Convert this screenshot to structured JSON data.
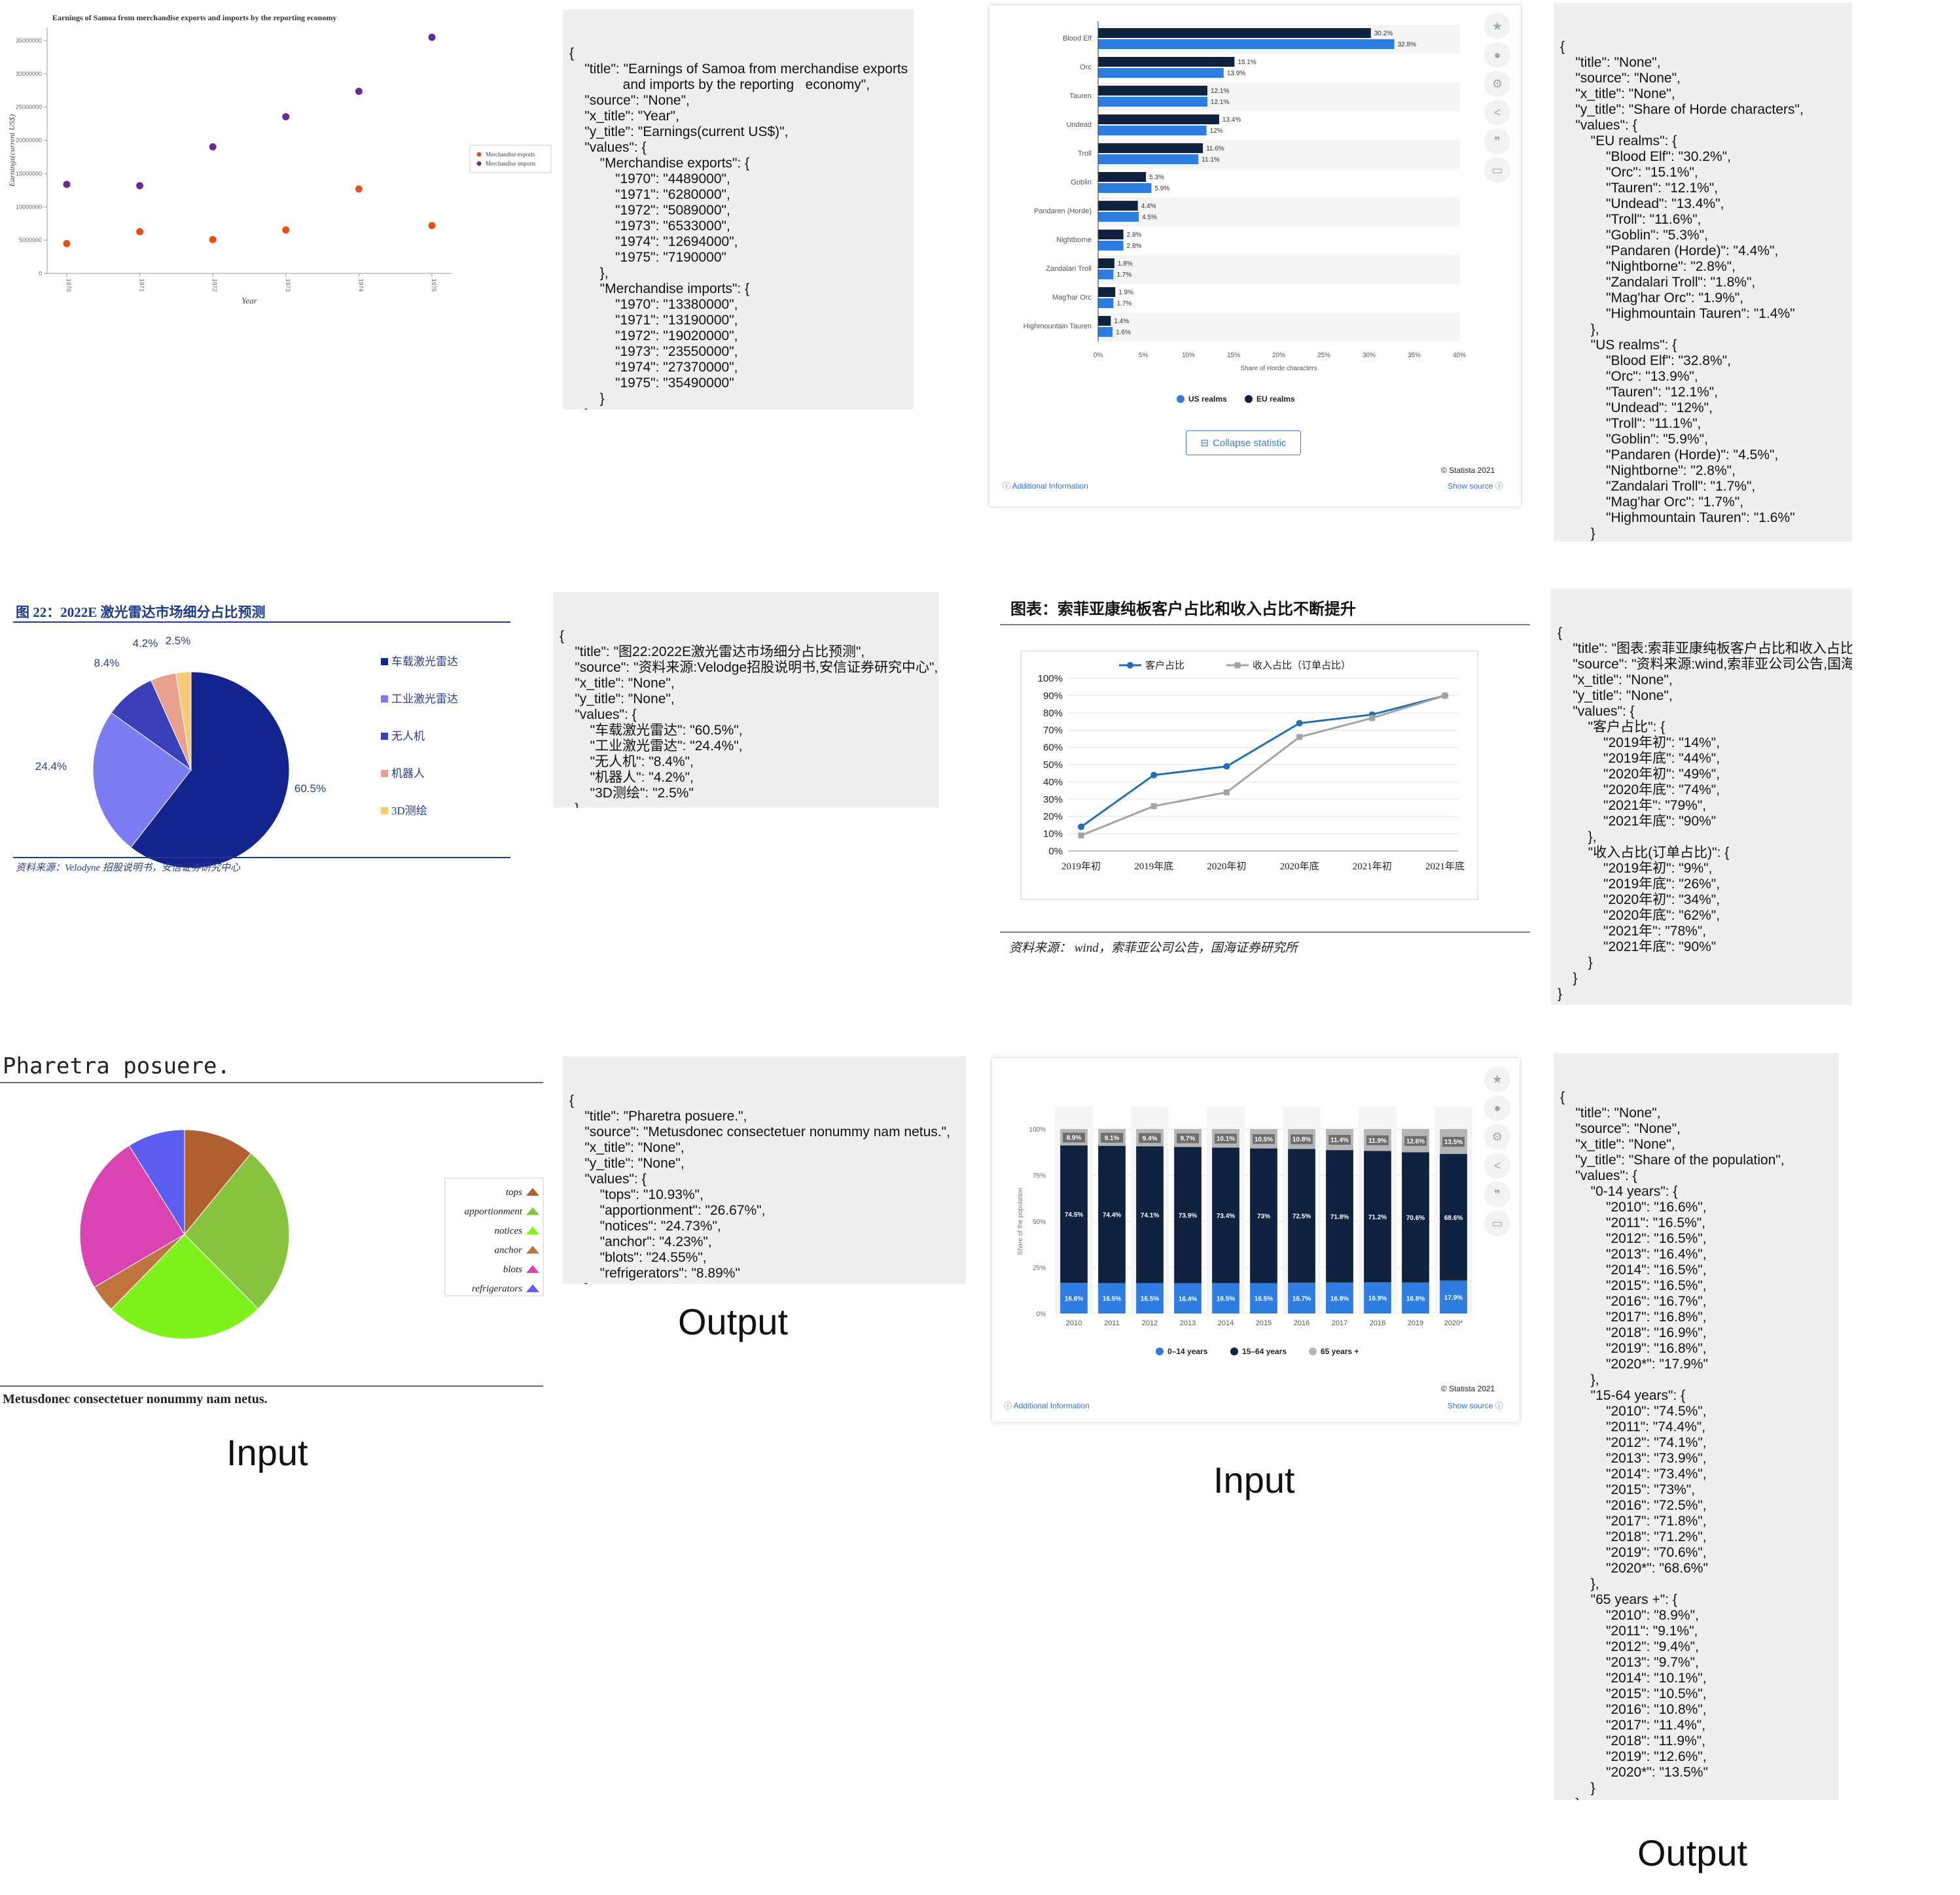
{
  "captions": {
    "input_1": "Input",
    "output_1": "Output",
    "input_2": "Input",
    "output_2": "Output"
  },
  "json_boxes": {
    "samoa": "{\n    \"title\": \"Earnings of Samoa from merchandise exports\n              and imports by the reporting   economy\",\n    \"source\": \"None\",\n    \"x_title\": \"Year\",\n    \"y_title\": \"Earnings(current US$)\",\n    \"values\": {\n        \"Merchandise exports\": {\n            \"1970\": \"4489000\",\n            \"1971\": \"6280000\",\n            \"1972\": \"5089000\",\n            \"1973\": \"6533000\",\n            \"1974\": \"12694000\",\n            \"1975\": \"7190000\"\n        },\n        \"Merchandise imports\": {\n            \"1970\": \"13380000\",\n            \"1971\": \"13190000\",\n            \"1972\": \"19020000\",\n            \"1973\": \"23550000\",\n            \"1974\": \"27370000\",\n            \"1975\": \"35490000\"\n        }\n    }\n}",
    "horde": "{\n    \"title\": \"None\",\n    \"source\": \"None\",\n    \"x_title\": \"None\",\n    \"y_title\": \"Share of Horde characters\",\n    \"values\": {\n        \"EU realms\": {\n            \"Blood Elf\": \"30.2%\",\n            \"Orc\": \"15.1%\",\n            \"Tauren\": \"12.1%\",\n            \"Undead\": \"13.4%\",\n            \"Troll\": \"11.6%\",\n            \"Goblin\": \"5.3%\",\n            \"Pandaren (Horde)\": \"4.4%\",\n            \"Nightborne\": \"2.8%\",\n            \"Zandalari Troll\": \"1.8%\",\n            \"Mag'har Orc\": \"1.9%\",\n            \"Highmountain Tauren\": \"1.4%\"\n        },\n        \"US realms\": {\n            \"Blood Elf\": \"32.8%\",\n            \"Orc\": \"13.9%\",\n            \"Tauren\": \"12.1%\",\n            \"Undead\": \"12%\",\n            \"Troll\": \"11.1%\",\n            \"Goblin\": \"5.9%\",\n            \"Pandaren (Horde)\": \"4.5%\",\n            \"Nightborne\": \"2.8%\",\n            \"Zandalari Troll\": \"1.7%\",\n            \"Mag'har Orc\": \"1.7%\",\n            \"Highmountain Tauren\": \"1.6%\"\n        }\n    }\n}",
    "lidar": "{\n    \"title\": \"图22:2022E激光雷达市场细分占比预测\",\n    \"source\": \"资料来源:Velodge招股说明书,安信证券研究中心\",\n    \"x_title\": \"None\",\n    \"y_title\": \"None\",\n    \"values\": {\n        \"车载激光雷达\": \"60.5%\",\n        \"工业激光雷达\": \"24.4%\",\n        \"无人机\": \"8.4%\",\n        \"机器人\": \"4.2%\",\n        \"3D测绘\": \"2.5%\"\n    }\n}",
    "sofia": "{\n    \"title\": \"图表:索菲亚康纯板客户占比和收入占比不断提升\",\n    \"source\": \"资料来源:wind,索菲亚公司公告,国海证券研究所\",\n    \"x_title\": \"None\",\n    \"y_title\": \"None\",\n    \"values\": {\n        \"客户占比\": {\n            \"2019年初\": \"14%\",\n            \"2019年底\": \"44%\",\n            \"2020年初\": \"49%\",\n            \"2020年底\": \"74%\",\n            \"2021年\": \"79%\",\n            \"2021年底\": \"90%\"\n        },\n        \"收入占比(订单占比)\": {\n            \"2019年初\": \"9%\",\n            \"2019年底\": \"26%\",\n            \"2020年初\": \"34%\",\n            \"2020年底\": \"62%\",\n            \"2021年\": \"78%\",\n            \"2021年底\": \"90%\"\n        }\n    }\n}",
    "pharetra": "{\n    \"title\": \"Pharetra posuere.\",\n    \"source\": \"Metusdonec consectetuer nonummy nam netus.\",\n    \"x_title\": \"None\",\n    \"y_title\": \"None\",\n    \"values\": {\n        \"tops\": \"10.93%\",\n        \"apportionment\": \"26.67%\",\n        \"notices\": \"24.73%\",\n        \"anchor\": \"4.23%\",\n        \"blots\": \"24.55%\",\n        \"refrigerators\": \"8.89%\"\n    }\n}",
    "population": "{\n    \"title\": \"None\",\n    \"source\": \"None\",\n    \"x_title\": \"None\",\n    \"y_title\": \"Share of the population\",\n    \"values\": {\n        \"0-14 years\": {\n            \"2010\": \"16.6%\",\n            \"2011\": \"16.5%\",\n            \"2012\": \"16.5%\",\n            \"2013\": \"16.4%\",\n            \"2014\": \"16.5%\",\n            \"2015\": \"16.5%\",\n            \"2016\": \"16.7%\",\n            \"2017\": \"16.8%\",\n            \"2018\": \"16.9%\",\n            \"2019\": \"16.8%\",\n            \"2020*\": \"17.9%\"\n        },\n        \"15-64 years\": {\n            \"2010\": \"74.5%\",\n            \"2011\": \"74.4%\",\n            \"2012\": \"74.1%\",\n            \"2013\": \"73.9%\",\n            \"2014\": \"73.4%\",\n            \"2015\": \"73%\",\n            \"2016\": \"72.5%\",\n            \"2017\": \"71.8%\",\n            \"2018\": \"71.2%\",\n            \"2019\": \"70.6%\",\n            \"2020*\": \"68.6%\"\n        },\n        \"65 years +\": {\n            \"2010\": \"8.9%\",\n            \"2011\": \"9.1%\",\n            \"2012\": \"9.4%\",\n            \"2013\": \"9.7%\",\n            \"2014\": \"10.1%\",\n            \"2015\": \"10.5%\",\n            \"2016\": \"10.8%\",\n            \"2017\": \"11.4%\",\n            \"2018\": \"11.9%\",\n            \"2019\": \"12.6%\",\n            \"2020*\": \"13.5%\"\n        }\n    }\n}"
  },
  "statista": {
    "collapse_label": "Collapse statistic",
    "copyright": "© Statista 2021",
    "additional_info": "Additional Information",
    "show_source": "Show source"
  },
  "chart_data": [
    {
      "id": "samoa",
      "type": "scatter",
      "title": "Earnings of Samoa from merchandise exports and imports by the reporting economy",
      "xlabel": "Year",
      "ylabel": "Earnings(current US$)",
      "x": [
        "1970",
        "1971",
        "1972",
        "1973",
        "1974",
        "1975"
      ],
      "ylim": [
        0,
        35000000
      ],
      "yticks": [
        "0",
        "5000000",
        "10000000",
        "15000000",
        "20000000",
        "25000000",
        "30000000",
        "35000000"
      ],
      "series": [
        {
          "name": "Merchandise exports",
          "color": "#e8501a",
          "values": [
            4489000,
            6280000,
            5089000,
            6533000,
            12694000,
            7190000
          ]
        },
        {
          "name": "Merchandise imports",
          "color": "#6a2c91",
          "values": [
            13380000,
            13190000,
            19020000,
            23550000,
            27370000,
            35490000
          ]
        }
      ],
      "legend": "right"
    },
    {
      "id": "horde",
      "type": "bar",
      "orientation": "horizontal",
      "xlabel": "Share of Horde characters",
      "categories": [
        "Blood Elf",
        "Orc",
        "Tauren",
        "Undead",
        "Troll",
        "Goblin",
        "Pandaren (Horde)",
        "Nightborne",
        "Zandalari Troll",
        "Mag'har Orc",
        "Highmountain Tauren"
      ],
      "xticks": [
        "0%",
        "5%",
        "10%",
        "15%",
        "20%",
        "25%",
        "30%",
        "35%",
        "40%"
      ],
      "xlim": [
        0,
        40
      ],
      "series": [
        {
          "name": "EU realms",
          "color": "#0f2240",
          "values": [
            30.2,
            15.1,
            12.1,
            13.4,
            11.6,
            5.3,
            4.4,
            2.8,
            1.8,
            1.9,
            1.4
          ],
          "labels": [
            "30.2%",
            "15.1%",
            "12.1%",
            "13.4%",
            "11.6%",
            "5.3%",
            "4.4%",
            "2.8%",
            "1.8%",
            "1.9%",
            "1.4%"
          ]
        },
        {
          "name": "US realms",
          "color": "#2f7de1",
          "values": [
            32.8,
            13.9,
            12.1,
            12,
            11.1,
            5.9,
            4.5,
            2.8,
            1.7,
            1.7,
            1.6
          ],
          "labels": [
            "32.8%",
            "13.9%",
            "12.1%",
            "12%",
            "11.1%",
            "5.9%",
            "4.5%",
            "2.8%",
            "1.7%",
            "1.7%",
            "1.6%"
          ]
        }
      ],
      "legend_order": [
        "US realms",
        "EU realms"
      ],
      "legend": "bottom"
    },
    {
      "id": "lidar",
      "type": "pie",
      "title": "图 22：2022E 激光雷达市场细分占比预测",
      "source": "资料来源：Velodyne 招股说明书，安信证券研究中心",
      "categories": [
        "车载激光雷达",
        "工业激光雷达",
        "无人机",
        "机器人",
        "3D测绘"
      ],
      "values": [
        60.5,
        24.4,
        8.4,
        4.2,
        2.5
      ],
      "labels": [
        "60.5%",
        "24.4%",
        "8.4%",
        "4.2%",
        "2.5%"
      ],
      "colors": [
        "#14248f",
        "#7b7cf2",
        "#3b3fb8",
        "#e8a18e",
        "#f7c97a"
      ],
      "legend": "right"
    },
    {
      "id": "sofia",
      "type": "line",
      "title": "图表：索菲亚康纯板客户占比和收入占比不断提升",
      "source": "资料来源：  wind，索菲亚公司公告，国海证券研究所",
      "categories": [
        "2019年初",
        "2019年底",
        "2020年初",
        "2020年底",
        "2021年初",
        "2021年底"
      ],
      "ylim": [
        0,
        100
      ],
      "yticks": [
        "0%",
        "10%",
        "20%",
        "30%",
        "40%",
        "50%",
        "60%",
        "70%",
        "80%",
        "90%",
        "100%"
      ],
      "series": [
        {
          "name": "客户占比",
          "color": "#1f6fb5",
          "values": [
            14,
            44,
            49,
            74,
            79,
            90
          ]
        },
        {
          "name": "收入占比（订单占比）",
          "color": "#a3a3a3",
          "values": [
            9,
            26,
            34,
            66,
            77,
            90
          ]
        }
      ],
      "legend": "top"
    },
    {
      "id": "pharetra",
      "type": "pie",
      "title": "Pharetra posuere.",
      "source": "Metusdonec consectetuer nonummy nam netus.",
      "categories": [
        "tops",
        "apportionment",
        "notices",
        "anchor",
        "blots",
        "refrigerators"
      ],
      "values": [
        10.93,
        26.67,
        24.73,
        4.23,
        24.55,
        8.89
      ],
      "colors": [
        "#b0602e",
        "#86c440",
        "#7ff21e",
        "#c0743e",
        "#d943b2",
        "#5b5cf0"
      ],
      "legend": "right"
    },
    {
      "id": "population",
      "type": "bar",
      "stacked": true,
      "ylabel": "Share of the population",
      "categories": [
        "2010",
        "2011",
        "2012",
        "2013",
        "2014",
        "2015",
        "2016",
        "2017",
        "2018",
        "2019",
        "2020*"
      ],
      "yticks": [
        "0%",
        "25%",
        "50%",
        "75%",
        "100%"
      ],
      "ylim": [
        0,
        100
      ],
      "series": [
        {
          "name": "0-14 years",
          "color": "#2f7de1",
          "values": [
            16.6,
            16.5,
            16.5,
            16.4,
            16.5,
            16.5,
            16.7,
            16.8,
            16.9,
            16.8,
            17.9
          ],
          "labels": [
            "16.6%",
            "16.5%",
            "16.5%",
            "16.4%",
            "16.5%",
            "16.5%",
            "16.7%",
            "16.8%",
            "16.9%",
            "16.8%",
            "17.9%"
          ]
        },
        {
          "name": "15-64 years",
          "color": "#0f2240",
          "values": [
            74.5,
            74.4,
            74.1,
            73.9,
            73.4,
            73,
            72.5,
            71.8,
            71.2,
            70.6,
            68.6
          ],
          "labels": [
            "74.5%",
            "74.4%",
            "74.1%",
            "73.9%",
            "73.4%",
            "73%",
            "72.5%",
            "71.8%",
            "71.2%",
            "70.6%",
            "68.6%"
          ]
        },
        {
          "name": "65 years +",
          "color": "#b5b5b5",
          "values": [
            8.9,
            9.1,
            9.4,
            9.7,
            10.1,
            10.5,
            10.8,
            11.4,
            11.9,
            12.6,
            13.5
          ],
          "labels": [
            "8.9%",
            "9.1%",
            "9.4%",
            "9.7%",
            "10.1%",
            "10.5%",
            "10.8%",
            "11.4%",
            "11.9%",
            "12.6%",
            "13.5%"
          ]
        }
      ],
      "legend_labels": [
        "0–14 years",
        "15–64 years",
        "65 years +"
      ],
      "legend": "bottom"
    }
  ]
}
